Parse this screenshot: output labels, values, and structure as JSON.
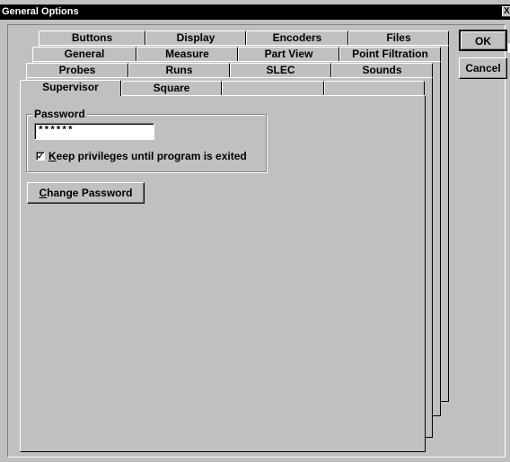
{
  "window": {
    "title": "General Options",
    "close_label": "X"
  },
  "buttons": {
    "ok": "OK",
    "cancel": "Cancel",
    "change_password": "Change Password"
  },
  "tabs": {
    "row1": [
      "Buttons",
      "Display",
      "Encoders",
      "Files"
    ],
    "row2": [
      "General",
      "Measure",
      "Part View",
      "Point Filtration"
    ],
    "row3": [
      "Probes",
      "Runs",
      "SLEC",
      "Sounds"
    ],
    "row4": [
      "Supervisor",
      "Square",
      "",
      ""
    ]
  },
  "selected_tab": "Supervisor",
  "password_group": {
    "label": "Password",
    "value": "******",
    "keep_privileges_label": "Keep privileges until program is exited",
    "keep_privileges_checked": true
  }
}
